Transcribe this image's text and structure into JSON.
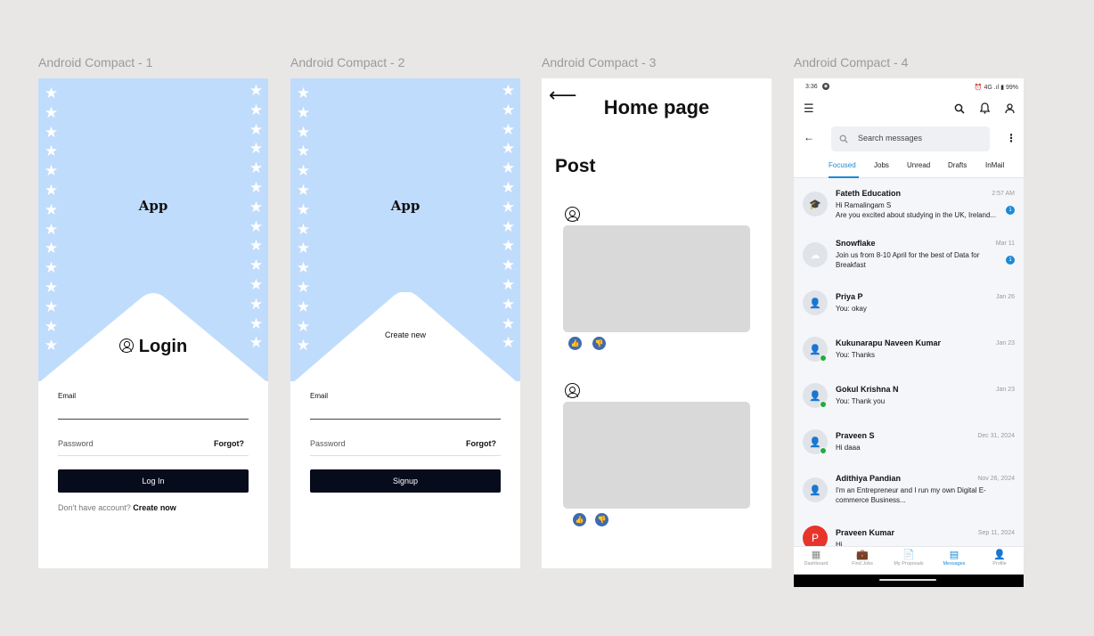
{
  "frames": {
    "login": {
      "label": "Android Compact - 1",
      "app_name": "App",
      "heading": "Login",
      "email_label": "Email",
      "password_label": "Password",
      "forgot": "Forgot?",
      "button": "Log In",
      "account_prompt": "Don't have account?",
      "account_link": "Create now"
    },
    "signup": {
      "label": "Android Compact - 2",
      "app_name": "App",
      "heading": "Create new",
      "email_label": "Email",
      "password_label": "Password",
      "forgot": "Forgot?",
      "button": "Signup"
    },
    "home": {
      "label": "Android Compact - 3",
      "back": "⟵",
      "title": "Home page",
      "section": "Post"
    },
    "messages": {
      "label": "Android Compact - 4",
      "status_time": "3:36",
      "status_right": "⏰ 4G .ıl ▮ 99%",
      "search_placeholder": "Search messages",
      "tabs": [
        "Focused",
        "Jobs",
        "Unread",
        "Drafts",
        "InMail"
      ],
      "conversations": [
        {
          "name": "Fateth Education",
          "time": "2:57 AM",
          "line1": "Hi Ramalingam S",
          "line2": "Are you excited about studying in the UK, Ireland...",
          "badge": "1",
          "avatar": "🎓"
        },
        {
          "name": "Snowflake",
          "time": "Mar 11",
          "line1": "Join us from 8-10 April for the best of Data for",
          "line2": "Breakfast",
          "badge": "1",
          "avatar": "☁"
        },
        {
          "name": "Priya P",
          "time": "Jan 26",
          "line1": "You: okay",
          "avatar": "👤"
        },
        {
          "name": "Kukunarapu Naveen Kumar",
          "time": "Jan 23",
          "line1": "You: Thanks",
          "avatar": "👤"
        },
        {
          "name": "Gokul Krishna N",
          "time": "Jan 23",
          "line1": "You: Thank you",
          "avatar": "👤"
        },
        {
          "name": "Praveen S",
          "time": "Dec 31, 2024",
          "line1": "Hi daaa",
          "avatar": "👤"
        },
        {
          "name": "Adithiya Pandian",
          "time": "Nov 26, 2024",
          "line1": "I'm an Entrepreneur and I run my own Digital E-",
          "line2": "commerce Business...",
          "avatar": "👤"
        },
        {
          "name": "Praveen Kumar",
          "time": "Sep 11, 2024",
          "line1": "Hi",
          "avatar": "P"
        }
      ],
      "nav": [
        "Dashboard",
        "Find Jobs",
        "My Proposals",
        "Messages",
        "Profile"
      ]
    }
  },
  "colors": {
    "canvas": "#e8e7e6",
    "auth_top": "#c0dcfc",
    "button_dark": "#070c1c",
    "accent": "#1b8ad8",
    "online": "#1fae3a",
    "reaction": "#3d6bb0"
  }
}
